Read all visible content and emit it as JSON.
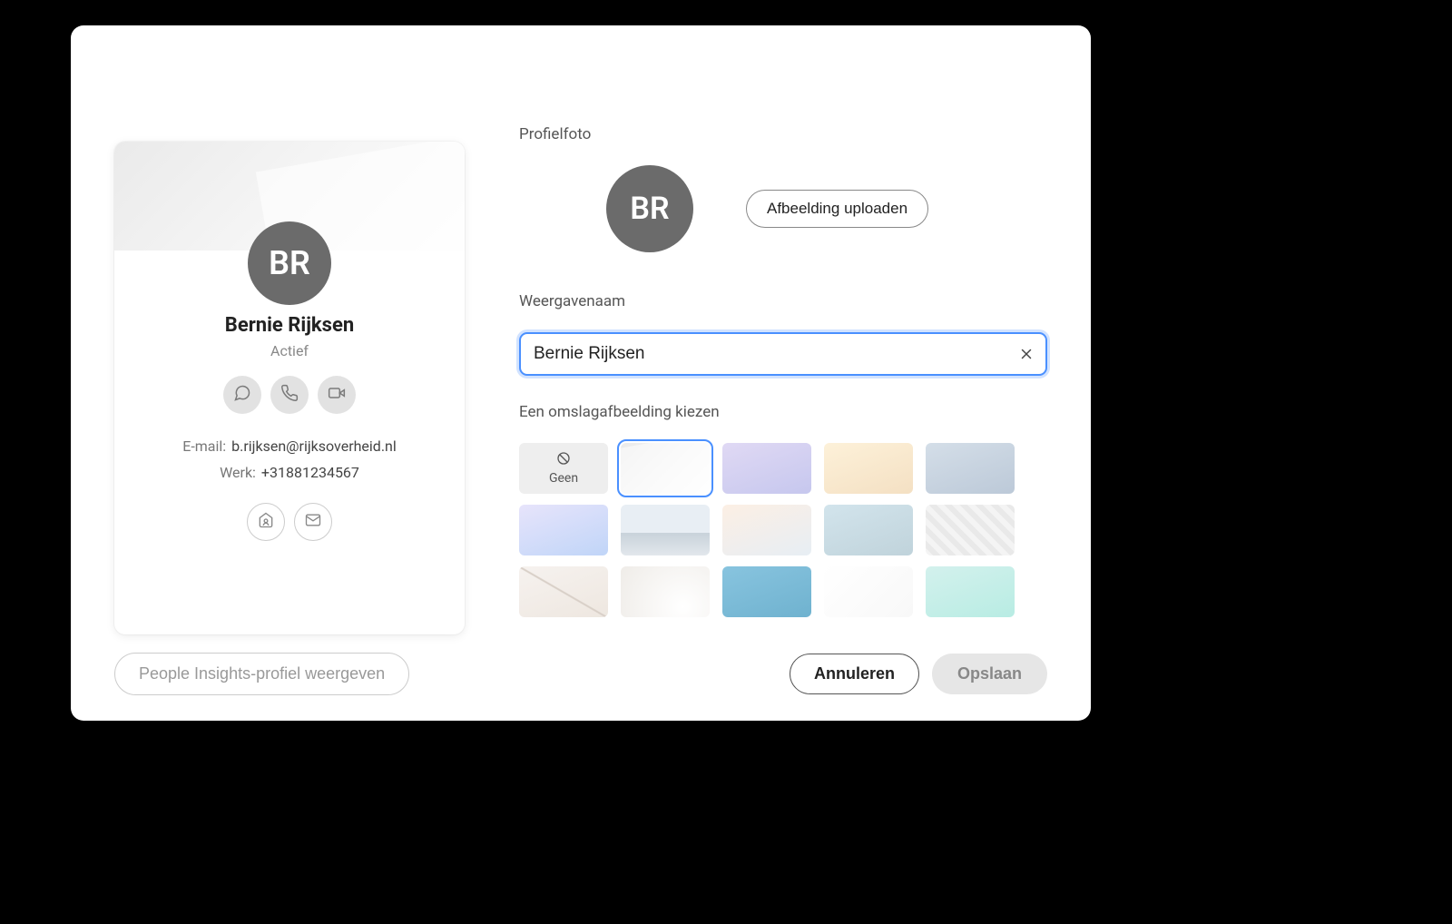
{
  "profile": {
    "initials": "BR",
    "name": "Bernie Rijksen",
    "status": "Actief",
    "email_label": "E-mail:",
    "email_value": "b.rijksen@rijksoverheid.nl",
    "work_label": "Werk:",
    "work_value": "+31881234567"
  },
  "right": {
    "photo_section_label": "Profielfoto",
    "avatar_initials": "BR",
    "upload_button": "Afbeelding uploaden",
    "display_name_label": "Weergavenaam",
    "display_name_value": "Bernie Rijksen",
    "cover_section_label": "Een omslagafbeelding kiezen",
    "none_label": "Geen"
  },
  "footer": {
    "insights_button": "People Insights-profiel weergeven",
    "cancel_button": "Annuleren",
    "save_button": "Opslaan"
  }
}
